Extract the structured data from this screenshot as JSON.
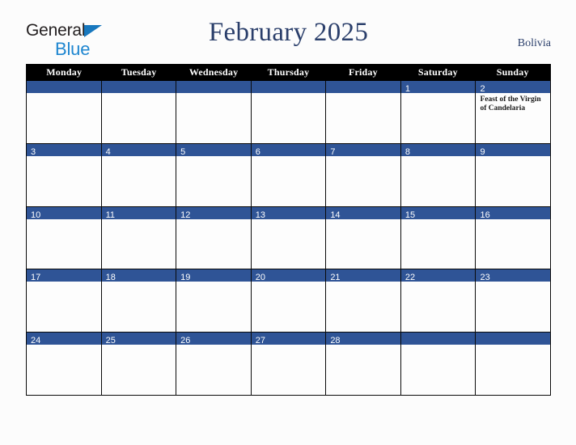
{
  "brand": {
    "word1": "General",
    "word2": "Blue",
    "triangle_color": "#1878be",
    "word2_color": "#1e86d0",
    "word1_color": "#231f20"
  },
  "header": {
    "title": "February 2025",
    "country": "Bolivia",
    "title_color": "#2b3f6b"
  },
  "colors": {
    "daybar": "#2f5496",
    "weekday_header_bg": "#000000",
    "weekday_header_text": "#ffffff",
    "grid_line": "#0a0a0a",
    "cell_bg": "#fdfdfd",
    "page_bg": "#fcfcfc"
  },
  "weekdays": [
    "Monday",
    "Tuesday",
    "Wednesday",
    "Thursday",
    "Friday",
    "Saturday",
    "Sunday"
  ],
  "weeks": [
    [
      {
        "day": "",
        "events": []
      },
      {
        "day": "",
        "events": []
      },
      {
        "day": "",
        "events": []
      },
      {
        "day": "",
        "events": []
      },
      {
        "day": "",
        "events": []
      },
      {
        "day": "1",
        "events": []
      },
      {
        "day": "2",
        "events": [
          "Feast of the Virgin of Candelaria"
        ]
      }
    ],
    [
      {
        "day": "3",
        "events": []
      },
      {
        "day": "4",
        "events": []
      },
      {
        "day": "5",
        "events": []
      },
      {
        "day": "6",
        "events": []
      },
      {
        "day": "7",
        "events": []
      },
      {
        "day": "8",
        "events": []
      },
      {
        "day": "9",
        "events": []
      }
    ],
    [
      {
        "day": "10",
        "events": []
      },
      {
        "day": "11",
        "events": []
      },
      {
        "day": "12",
        "events": []
      },
      {
        "day": "13",
        "events": []
      },
      {
        "day": "14",
        "events": []
      },
      {
        "day": "15",
        "events": []
      },
      {
        "day": "16",
        "events": []
      }
    ],
    [
      {
        "day": "17",
        "events": []
      },
      {
        "day": "18",
        "events": []
      },
      {
        "day": "19",
        "events": []
      },
      {
        "day": "20",
        "events": []
      },
      {
        "day": "21",
        "events": []
      },
      {
        "day": "22",
        "events": []
      },
      {
        "day": "23",
        "events": []
      }
    ],
    [
      {
        "day": "24",
        "events": []
      },
      {
        "day": "25",
        "events": []
      },
      {
        "day": "26",
        "events": []
      },
      {
        "day": "27",
        "events": []
      },
      {
        "day": "28",
        "events": []
      },
      {
        "day": "",
        "events": []
      },
      {
        "day": "",
        "events": []
      }
    ]
  ]
}
